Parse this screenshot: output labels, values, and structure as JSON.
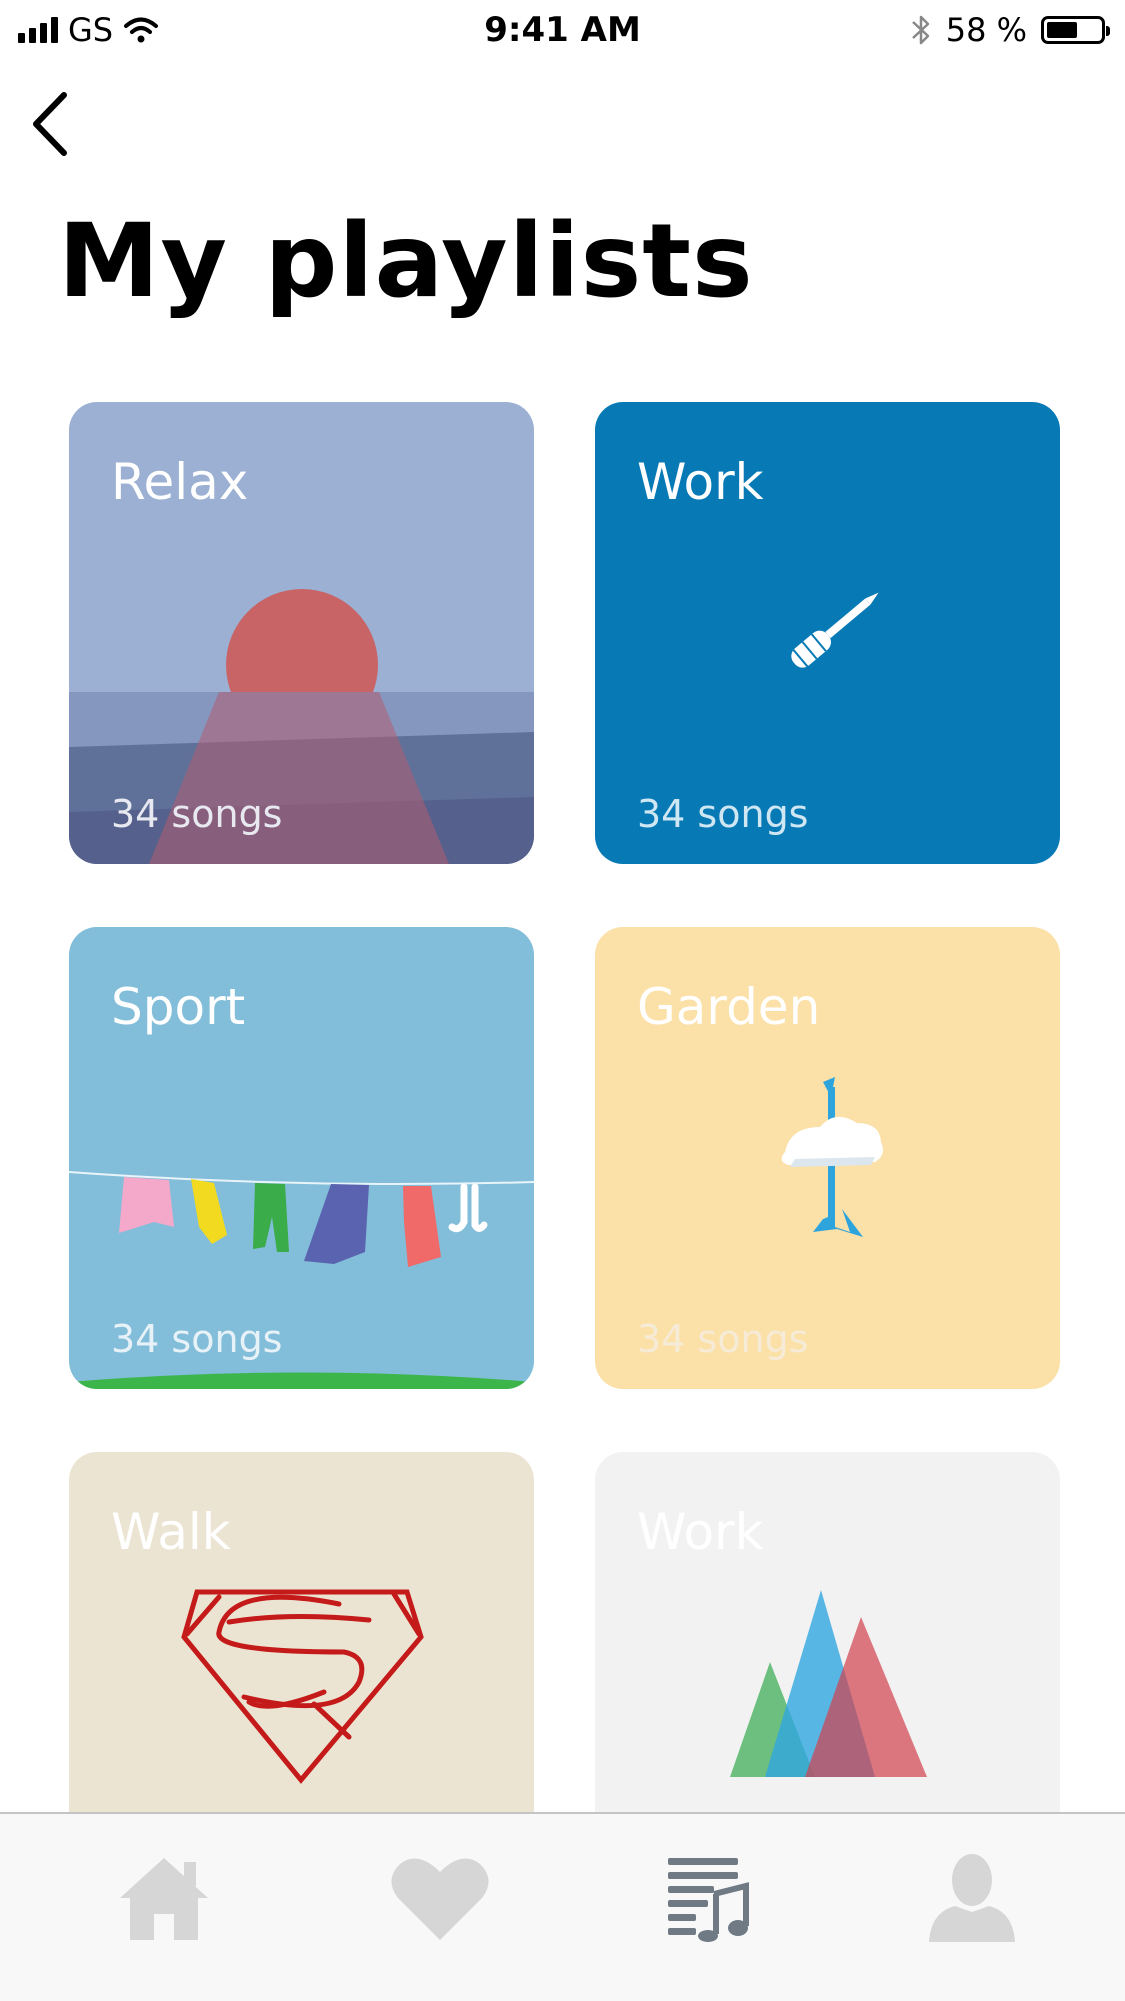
{
  "status_bar": {
    "carrier": "GS",
    "time": "9:41 AM",
    "battery_percent": "58 %",
    "battery_level": 0.58,
    "icons": [
      "signal-icon",
      "wifi-icon",
      "bluetooth-icon",
      "battery-icon"
    ]
  },
  "nav": {
    "back_icon": "chevron-left-icon"
  },
  "page_title": "My playlists",
  "playlists": [
    {
      "title": "Relax",
      "count": "34 songs",
      "artwork": "sunset-artwork",
      "color": "#9bb0d2"
    },
    {
      "title": "Work",
      "count": "34 songs",
      "artwork": "screwdriver-artwork",
      "color": "#0779b5"
    },
    {
      "title": "Sport",
      "count": "34 songs",
      "artwork": "clothesline-artwork",
      "color": "#82bdd9"
    },
    {
      "title": "Garden",
      "count": "34 songs",
      "artwork": "cloud-pole-artwork",
      "color": "#fbe0a8"
    },
    {
      "title": "Walk",
      "count": "",
      "artwork": "superman-logo-artwork",
      "color": "#ece4d2"
    },
    {
      "title": "Work",
      "count": "",
      "artwork": "mountains-artwork",
      "color": "#f2f2f2"
    }
  ],
  "tab_bar": {
    "tabs": [
      {
        "icon": "home-icon",
        "active": false
      },
      {
        "icon": "heart-icon",
        "active": false
      },
      {
        "icon": "playlist-icon",
        "active": true
      },
      {
        "icon": "profile-icon",
        "active": false
      }
    ],
    "active_color": "#6f7a85",
    "inactive_color": "#d6d6d6"
  }
}
